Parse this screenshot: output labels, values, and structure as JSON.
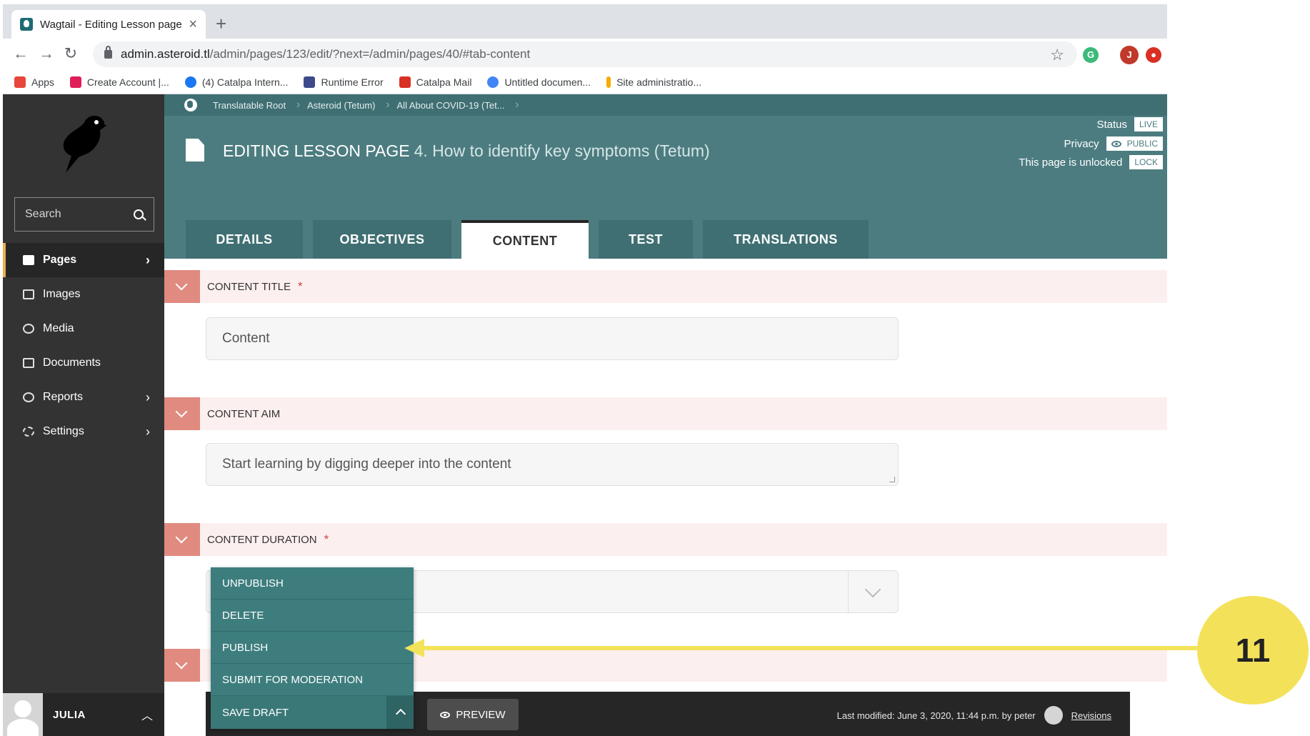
{
  "browser": {
    "tab_title": "Wagtail - Editing Lesson page:",
    "url_host": "admin.asteroid.tl",
    "url_path": "/admin/pages/123/edit/?next=/admin/pages/40/#tab-content",
    "profile_initial": "J",
    "bookmarks": [
      {
        "label": "Apps",
        "icon": "apps-grid-icon",
        "color": "#e8453c"
      },
      {
        "label": "Create Account |...",
        "icon": "slack-icon",
        "color": "#e01e5a"
      },
      {
        "label": "(4) Catalpa Intern...",
        "icon": "facebook-icon",
        "color": "#1877f2"
      },
      {
        "label": "Runtime Error",
        "icon": "runtime-icon",
        "color": "#3c4a8c"
      },
      {
        "label": "Catalpa Mail",
        "icon": "gmail-icon",
        "color": "#d93025"
      },
      {
        "label": "Untitled documen...",
        "icon": "google-icon",
        "color": "#4285f4"
      },
      {
        "label": "Site administratio...",
        "icon": "feather-icon",
        "color": "#f9ab00"
      }
    ]
  },
  "sidebar": {
    "search_placeholder": "Search",
    "items": [
      {
        "label": "Pages",
        "icon": "folder-icon",
        "active": true,
        "has_arrow": true
      },
      {
        "label": "Images",
        "icon": "image-icon",
        "active": false,
        "has_arrow": false
      },
      {
        "label": "Media",
        "icon": "media-icon",
        "active": false,
        "has_arrow": false
      },
      {
        "label": "Documents",
        "icon": "document-icon",
        "active": false,
        "has_arrow": false
      },
      {
        "label": "Reports",
        "icon": "reports-icon",
        "active": false,
        "has_arrow": true
      },
      {
        "label": "Settings",
        "icon": "cogs-icon",
        "active": false,
        "has_arrow": true
      }
    ],
    "account_name": "JULIA"
  },
  "header": {
    "breadcrumbs": [
      "Translatable Root",
      "Asteroid (Tetum)",
      "All About COVID-19 (Tet..."
    ],
    "title_prefix": "EDITING LESSON PAGE",
    "title_page": "4. How to identify key symptoms (Tetum)",
    "status_label": "Status",
    "status_value": "LIVE",
    "privacy_label": "Privacy",
    "privacy_value": "PUBLIC",
    "lock_label": "This page is unlocked",
    "lock_value": "LOCK",
    "tabs": [
      {
        "label": "DETAILS",
        "active": false
      },
      {
        "label": "OBJECTIVES",
        "active": false
      },
      {
        "label": "CONTENT",
        "active": true
      },
      {
        "label": "TEST",
        "active": false
      },
      {
        "label": "TRANSLATIONS",
        "active": false
      }
    ]
  },
  "content": {
    "sections": [
      {
        "label": "CONTENT TITLE",
        "required": true,
        "value": "Content"
      },
      {
        "label": "CONTENT AIM",
        "required": false,
        "value": "Start learning by digging deeper into the content"
      },
      {
        "label": "CONTENT DURATION",
        "required": true,
        "value": ""
      }
    ]
  },
  "actions": {
    "menu": [
      "UNPUBLISH",
      "DELETE",
      "PUBLISH",
      "SUBMIT FOR MODERATION"
    ],
    "primary": "SAVE DRAFT",
    "preview": "PREVIEW",
    "last_modified": "Last modified: June 3, 2020, 11:44 p.m. by peter",
    "revisions": "Revisions"
  },
  "annotation": {
    "step_number": "11",
    "color": "#f4e15a"
  }
}
